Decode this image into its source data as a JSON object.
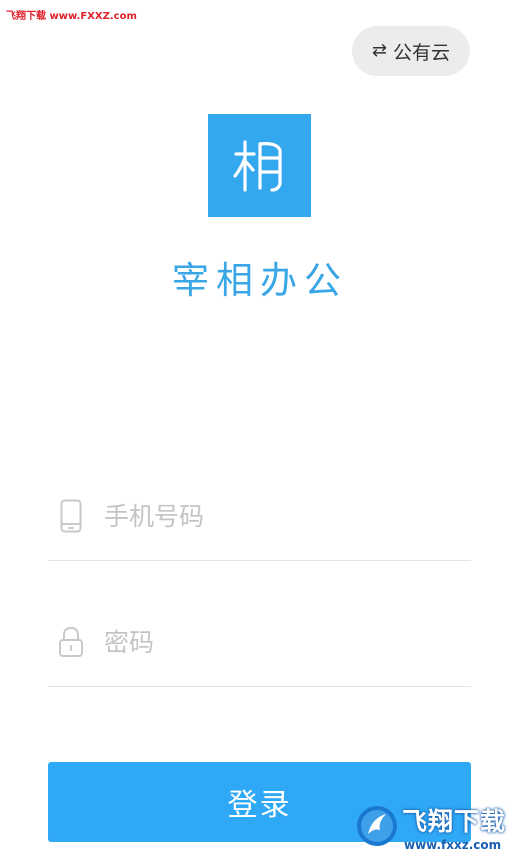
{
  "watermark_top": "飞翔下载 www.FXXZ.com",
  "server_toggle": {
    "icon": "swap-arrows-icon",
    "label": "公有云"
  },
  "logo": {
    "glyph": "相",
    "color": "#34a8ee"
  },
  "app_name": "宰相办公",
  "form": {
    "phone": {
      "icon": "phone-icon",
      "placeholder": "手机号码",
      "value": ""
    },
    "password": {
      "icon": "lock-icon",
      "placeholder": "密码",
      "value": ""
    },
    "login_label": "登录"
  },
  "watermark_bottom": {
    "text": "飞翔下载",
    "url": "www.fxxz.com"
  },
  "colors": {
    "accent": "#2fa8f5",
    "placeholder": "#c4c4c4",
    "divider": "#e3e3e3",
    "toggle_bg": "#ececec"
  }
}
